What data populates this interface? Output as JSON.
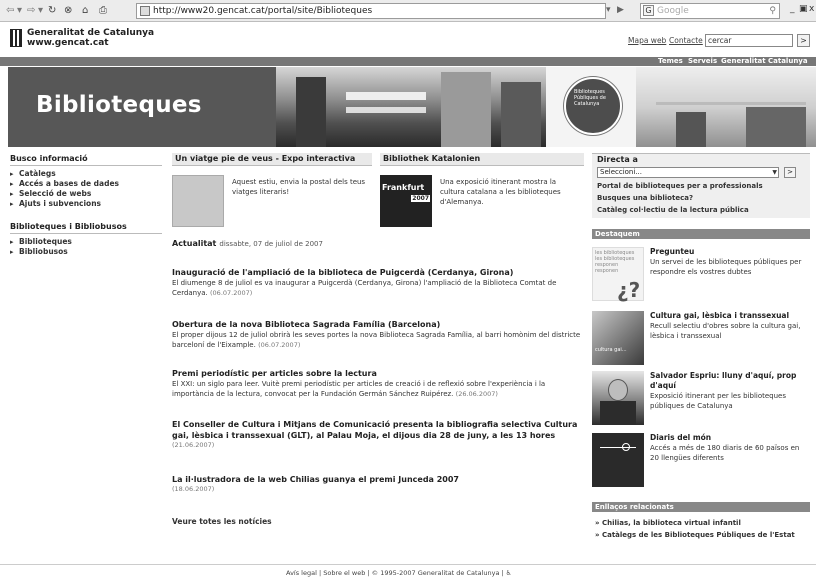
{
  "browser": {
    "url": "http://www20.gencat.cat/portal/site/Biblioteques",
    "search_placeholder": "Google",
    "search_engine_icon": "G"
  },
  "header": {
    "logo_line1": "Generalitat de Catalunya",
    "logo_line2": "www.gencat.cat",
    "links": [
      "Mapa web",
      "Contacte"
    ],
    "search_value": "cercar",
    "search_go": ">"
  },
  "nav": [
    "Temes",
    "Serveis",
    "Generalitat",
    "Catalunya"
  ],
  "banner": {
    "title": "Biblioteques",
    "logo_text": "Biblioteques Públiques de Catalunya",
    "colors": {
      "title_bg": "#575757",
      "nav_bg": "#777777"
    }
  },
  "left": {
    "section1_title": "Busco informació",
    "section1_items": [
      "Catàlegs",
      "Accés a bases de dades",
      "Selecció de webs",
      "Ajuts i subvencions"
    ],
    "section2_title": "Biblioteques i Bibliobusos",
    "section2_items": [
      "Biblioteques",
      "Bibliobusos"
    ]
  },
  "center": {
    "feature1": {
      "title": "Un viatge pie de veus - Expo interactiva",
      "text": "Aquest estiu, envia la postal dels teus viatges literaris!"
    },
    "feature2": {
      "title": "Bibliothek Katalonien",
      "image_label": "Frankfurt",
      "image_year": "2007",
      "text": "Una exposició itinerant mostra la cultura catalana a les biblioteques d'Alemanya."
    },
    "actualitat_label": "Actualitat",
    "actualitat_date": "dissabte, 07 de juliol de 2007",
    "news": [
      {
        "title": "Inauguració de l'ampliació de la biblioteca de Puigcerdà (Cerdanya, Girona)",
        "body": "El diumenge 8 de juliol es va inaugurar a Puigcerdà (Cerdanya, Girona) l'ampliació de la Biblioteca Comtat de Cerdanya.",
        "date": "(06.07.2007)"
      },
      {
        "title": "Obertura de la nova Biblioteca Sagrada Família (Barcelona)",
        "body": "El proper dijous 12 de juliol obrirà les seves portes la nova Biblioteca Sagrada Família, al barri homònim del districte barceloní de l'Eixample.",
        "date": "(06.07.2007)"
      },
      {
        "title": "Premi periodístic per articles sobre la lectura",
        "body": "El XXI: un siglo para leer. Vuitè premi periodístic per articles de creació i de reflexió sobre l'experiència i la importància de la lectura, convocat per la Fundación Germán Sánchez Ruipérez.",
        "date": "(26.06.2007)"
      },
      {
        "title": "El Conseller de Cultura i Mitjans de Comunicació presenta la bibliografia selectiva Cultura gai, lèsbica i transsexual (GLT), al Palau Moja, el dijous dia 28 de juny, a les 13 hores",
        "body": "",
        "date": "(21.06.2007)"
      },
      {
        "title": "La il·lustradora de la web Chilias guanya el premi Junceda 2007",
        "body": "",
        "date": "(18.06.2007)"
      }
    ],
    "all_news": "Veure totes les notícies"
  },
  "right": {
    "directa_title": "Directa a",
    "select_value": "Seleccioni...",
    "select_go": ">",
    "directa_links": [
      "Portal de biblioteques per a professionals",
      "Busques una biblioteca?",
      "Catàleg col·lectiu de la lectura pública"
    ],
    "destaquem_title": "Destaquem",
    "destaquem": [
      {
        "title": "Pregunteu",
        "body": "Un servei de les biblioteques públiques per respondre els vostres dubtes",
        "img_text": "les biblioteques les biblioteques responen responen"
      },
      {
        "title": "Cultura gai, lèsbica i transsexual",
        "body": "Recull selectiu d'obres sobre la cultura gai, lèsbica i transsexual",
        "img_text": "cultura gai..."
      },
      {
        "title": "Salvador Espriu: lluny d'aquí, prop d'aquí",
        "body": "Exposició itinerant per les biblioteques públiques de Catalunya",
        "img_text": ""
      },
      {
        "title": "Diaris del món",
        "body": "Accés a més de 180 diaris de 60 països en 20 llengües diferents",
        "img_text": ""
      }
    ],
    "related_title": "Enllaços relacionats",
    "related_links": [
      "Chilias, la biblioteca virtual infantil",
      "Catàlegs de les Biblioteques Públiques de l'Estat"
    ]
  },
  "footer": {
    "text": "Avís legal | Sobre el web | © 1995-2007 Generalitat de Catalunya |"
  }
}
